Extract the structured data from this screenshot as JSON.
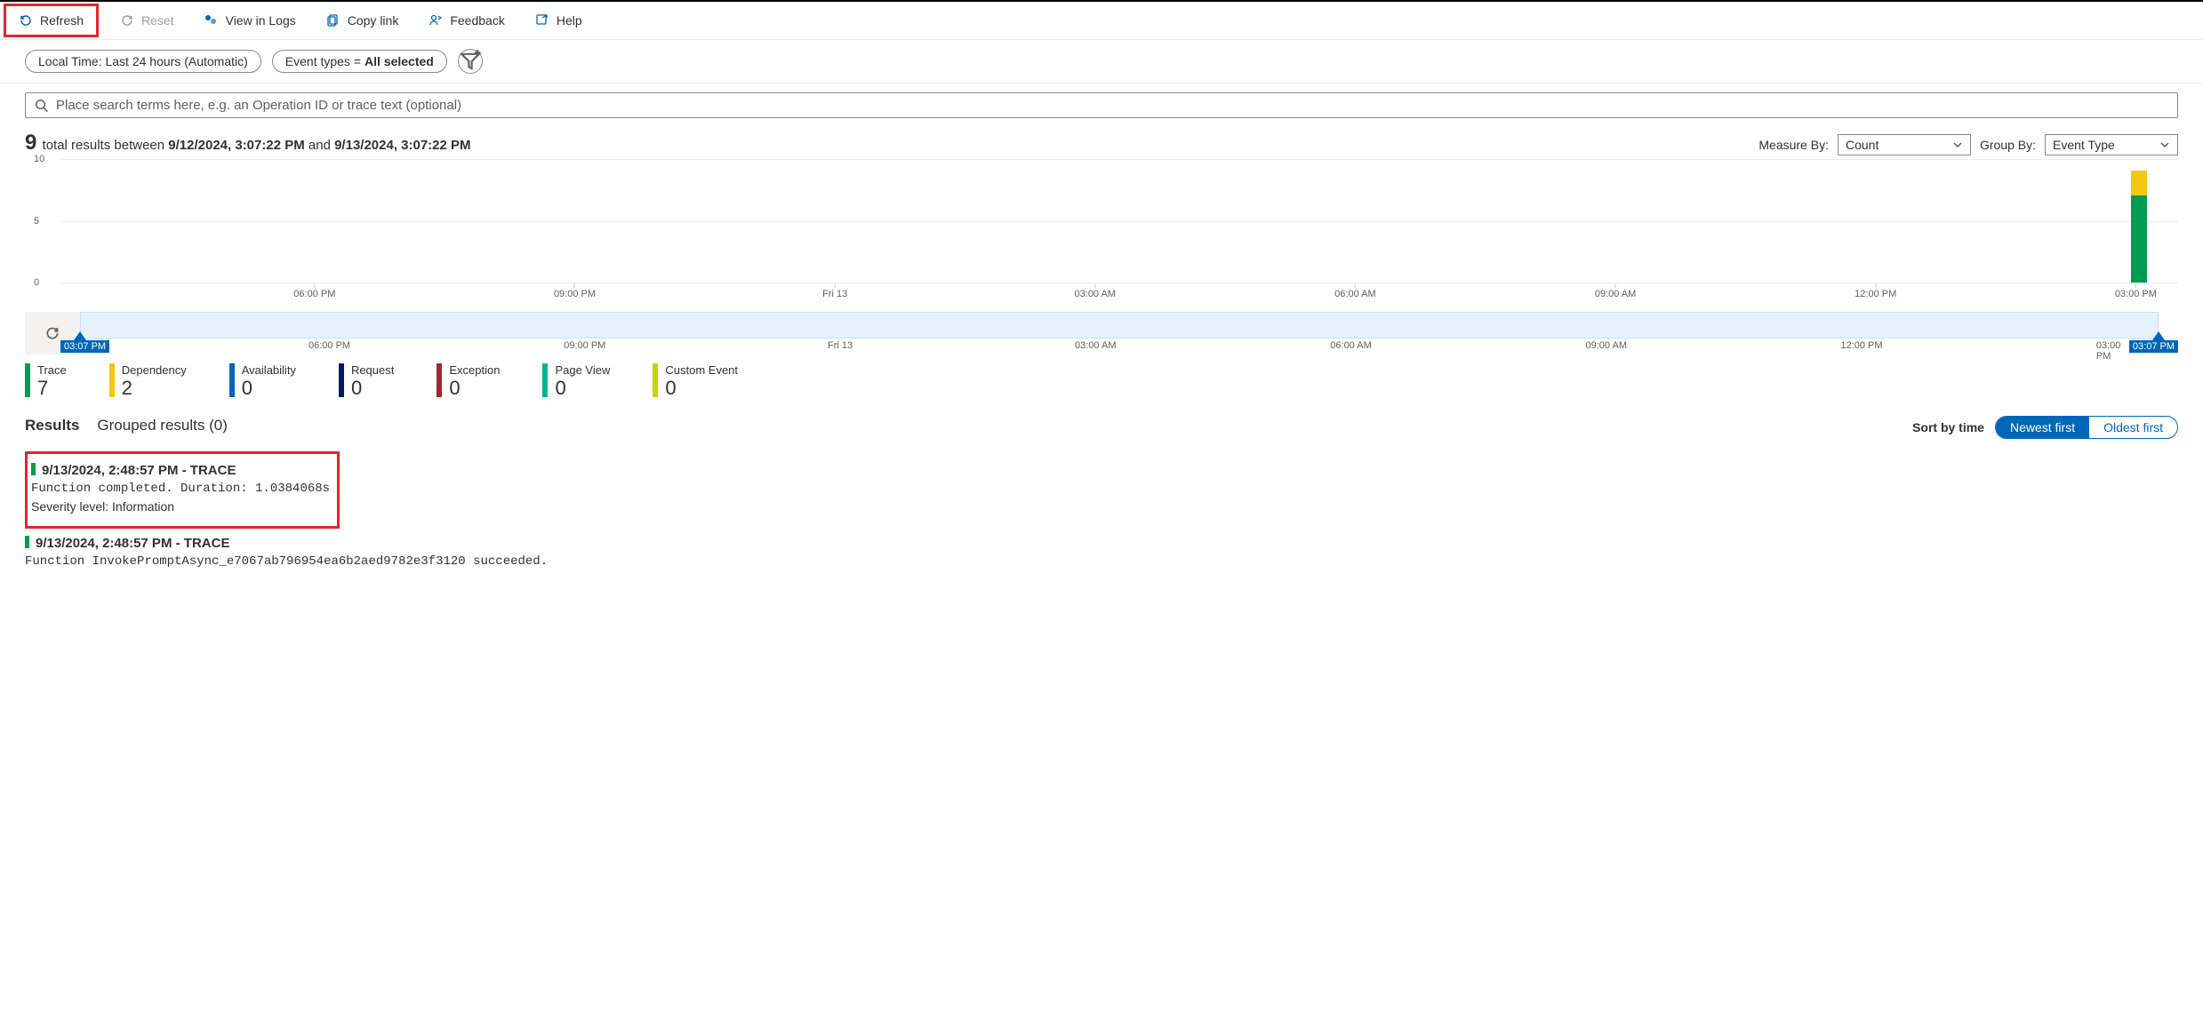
{
  "toolbar": {
    "refresh": "Refresh",
    "reset": "Reset",
    "view_in_logs": "View in Logs",
    "copy_link": "Copy link",
    "feedback": "Feedback",
    "help": "Help"
  },
  "filters": {
    "time_pill": "Local Time: Last 24 hours (Automatic)",
    "event_types_prefix": "Event types = ",
    "event_types_value": "All selected"
  },
  "search": {
    "placeholder": "Place search terms here, e.g. an Operation ID or trace text (optional)"
  },
  "summary": {
    "total_count": "9",
    "between_text": " total results between ",
    "start_dt": "9/12/2024, 3:07:22 PM",
    "and_text": " and ",
    "end_dt": "9/13/2024, 3:07:22 PM"
  },
  "controls": {
    "measure_by_label": "Measure By:",
    "measure_by_value": "Count",
    "group_by_label": "Group By:",
    "group_by_value": "Event Type"
  },
  "chart_data": {
    "type": "bar",
    "y_ticks": [
      "10",
      "5",
      "0"
    ],
    "y_max": 10,
    "x_ticks": [
      "06:00 PM",
      "09:00 PM",
      "Fri 13",
      "03:00 AM",
      "06:00 AM",
      "09:00 AM",
      "12:00 PM",
      "03:00 PM"
    ],
    "brush_ticks": [
      "06:00 PM",
      "09:00 PM",
      "Fri 13",
      "03:00 AM",
      "06:00 AM",
      "09:00 AM",
      "12:00 PM",
      "03:00 PM"
    ],
    "brush_start_label": "03:07 PM",
    "brush_end_label": "03:07 PM",
    "series_stack_last_bucket": {
      "Trace": 7,
      "Dependency": 2
    }
  },
  "legend": [
    {
      "label": "Trace",
      "count": "7",
      "color": "#009c51"
    },
    {
      "label": "Dependency",
      "count": "2",
      "color": "#f2c811"
    },
    {
      "label": "Availability",
      "count": "0",
      "color": "#0067b8"
    },
    {
      "label": "Request",
      "count": "0",
      "color": "#001a66"
    },
    {
      "label": "Exception",
      "count": "0",
      "color": "#a4262c"
    },
    {
      "label": "Page View",
      "count": "0",
      "color": "#00b294"
    },
    {
      "label": "Custom Event",
      "count": "0",
      "color": "#c3d600"
    }
  ],
  "tabs": {
    "results": "Results",
    "grouped": "Grouped results (0)"
  },
  "sort": {
    "label": "Sort by time",
    "newest": "Newest first",
    "oldest": "Oldest first"
  },
  "results": [
    {
      "time": "9/13/2024, 2:48:57 PM",
      "type": "TRACE",
      "message": "Function completed. Duration: 1.0384068s",
      "severity": "Severity level: Information"
    },
    {
      "time": "9/13/2024, 2:48:57 PM",
      "type": "TRACE",
      "message": "Function InvokePromptAsync_e7067ab796954ea6b2aed9782e3f3120 succeeded.",
      "severity": ""
    }
  ]
}
